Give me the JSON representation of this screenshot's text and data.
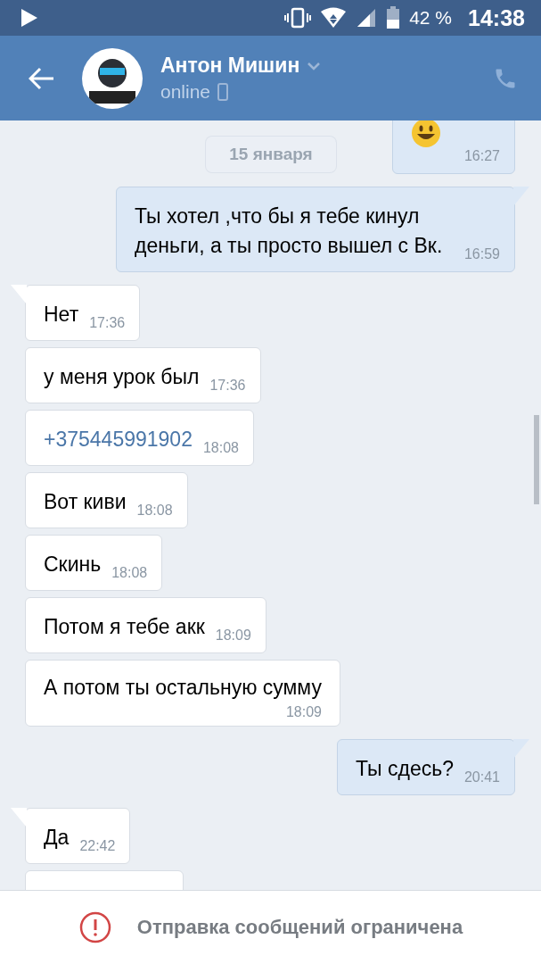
{
  "status_bar": {
    "battery": "42 %",
    "time": "14:38"
  },
  "header": {
    "name": "Антон Мишин",
    "status": "online"
  },
  "date_pill": "15 января",
  "messages": [
    {
      "kind": "emoji",
      "outgoing": true,
      "tail": false,
      "time": "16:27"
    },
    {
      "kind": "text",
      "outgoing": true,
      "tail": true,
      "text": "Ты хотел ,что бы я тебе кинул деньги, а ты просто вышел с Вк.",
      "time": "16:59"
    },
    {
      "kind": "text",
      "outgoing": false,
      "tail": true,
      "text": "Нет",
      "time": "17:36"
    },
    {
      "kind": "text",
      "outgoing": false,
      "tail": false,
      "text": "у  меня урок был",
      "time": "17:36"
    },
    {
      "kind": "link",
      "outgoing": false,
      "tail": false,
      "text": "+375445991902",
      "time": "18:08"
    },
    {
      "kind": "text",
      "outgoing": false,
      "tail": false,
      "text": "Вот киви",
      "time": "18:08"
    },
    {
      "kind": "text",
      "outgoing": false,
      "tail": false,
      "text": "Скинь",
      "time": "18:08"
    },
    {
      "kind": "text",
      "outgoing": false,
      "tail": false,
      "text": "Потом я тебе акк",
      "time": "18:09"
    },
    {
      "kind": "text",
      "outgoing": false,
      "tail": false,
      "text": "А потом ты остальную сумму",
      "time": "18:09",
      "time_below": true
    },
    {
      "kind": "text",
      "outgoing": true,
      "tail": true,
      "text": "Ты сдесь?",
      "time": "20:41"
    },
    {
      "kind": "text",
      "outgoing": false,
      "tail": true,
      "text": "Да",
      "time": "22:42"
    },
    {
      "kind": "partial",
      "outgoing": false,
      "tail": false
    }
  ],
  "notice": "Отправка сообщений ограничена"
}
